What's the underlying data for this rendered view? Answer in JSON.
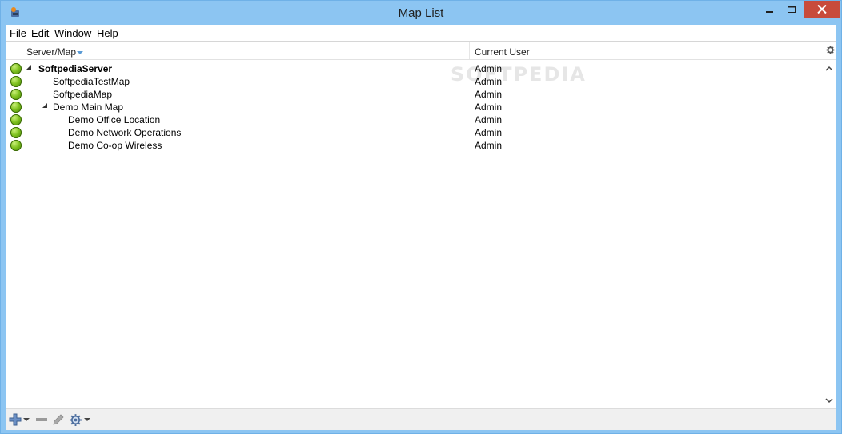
{
  "window": {
    "title": "Map List"
  },
  "menu": {
    "items": [
      "File",
      "Edit",
      "Window",
      "Help"
    ]
  },
  "columns": {
    "server_map": "Server/Map",
    "current_user": "Current User"
  },
  "rows": [
    {
      "name": "SoftpediaServer",
      "user": "Admin",
      "bold": true,
      "expanded": true,
      "status": "online"
    },
    {
      "name": "SoftpediaTestMap",
      "user": "Admin",
      "bold": false,
      "status": "online"
    },
    {
      "name": "SoftpediaMap",
      "user": "Admin",
      "bold": false,
      "status": "online"
    },
    {
      "name": "Demo Main Map",
      "user": "Admin",
      "bold": false,
      "expanded": true,
      "status": "online"
    },
    {
      "name": "Demo Office Location",
      "user": "Admin",
      "bold": false,
      "status": "online"
    },
    {
      "name": "Demo Network Operations",
      "user": "Admin",
      "bold": false,
      "status": "online"
    },
    {
      "name": "Demo Co-op Wireless",
      "user": "Admin",
      "bold": false,
      "status": "online"
    }
  ],
  "watermark": "SOFTPEDIA",
  "colors": {
    "title_bar": "#8cc5f2",
    "close_button": "#c84b3b",
    "status_online": "#6bb21a"
  },
  "icons": {
    "app": "app-icon",
    "minimize": "minimize-icon",
    "maximize": "maximize-icon",
    "close": "close-icon",
    "sort": "sort-desc-icon",
    "column_settings": "gear-icon",
    "add": "add-icon",
    "remove": "remove-icon",
    "edit": "pencil-icon",
    "settings": "gear-icon"
  }
}
